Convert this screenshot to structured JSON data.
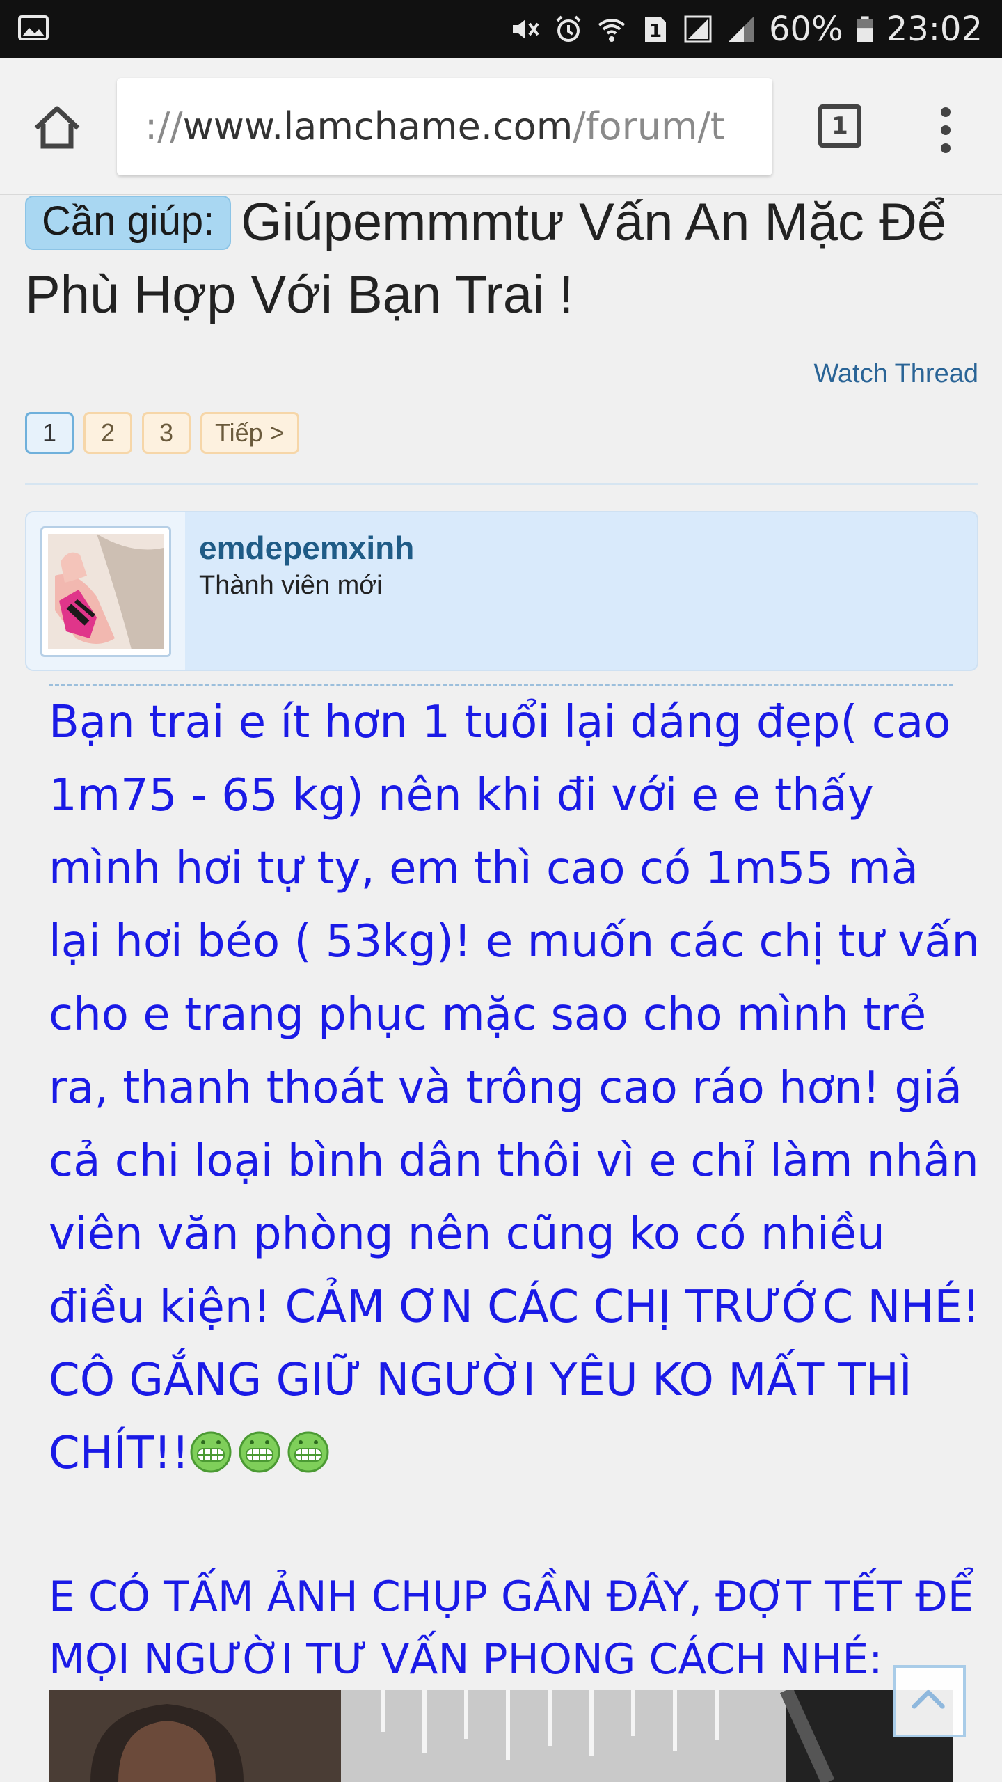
{
  "status_bar": {
    "battery": "60%",
    "time": "23:02",
    "sim_badge": "1",
    "icons": [
      "image-icon",
      "mute-icon",
      "alarm-icon",
      "wifi-icon",
      "sim-icon",
      "signal-icon",
      "battery-icon"
    ]
  },
  "browser": {
    "url_prefix": "://",
    "url_host": "www.lamchame.com",
    "url_path": "/forum/t",
    "tab_count": "1"
  },
  "thread": {
    "prefix": "Cần giúp:",
    "title": "Giúpemmmtư Vấn An Mặc Để Phù Hợp Với Bạn Trai !",
    "watch_label": "Watch Thread",
    "pages": [
      "1",
      "2",
      "3"
    ],
    "next_label": "Tiếp >",
    "current_page": "1"
  },
  "post": {
    "username": "emdepemxinh",
    "user_title": "Thành viên mới",
    "message": "Bạn trai e ít hơn 1 tuổi lại dáng đẹp( cao 1m75 - 65 kg) nên khi đi với e e thấy mình hơi tự ty, em thì cao có 1m55 mà lại hơi béo ( 53kg)! e muốn các chị tư vấn cho e trang phục mặc sao cho mình trẻ ra, thanh thoát và trông cao ráo hơn! giá cả chi loại bình dân thôi vì e chỉ làm nhân viên văn phòng nên cũng ko có nhiều điều kiện! CẢM ƠN CÁC CHỊ TRƯỚC NHÉ! CÔ GẮNG GIỮ NGƯỜI YÊU KO MẤT THÌ CHÍT!!",
    "emoji_count": 3,
    "message2": "E CÓ TẤM ẢNH CHỤP GẦN ĐÂY, ĐỢT TẾT ĐỂ MỌI NGƯỜI TƯ VẤN PHONG CÁCH NHÉ:"
  },
  "colors": {
    "message_text": "#1a1ae6",
    "username": "#1f5b86",
    "prefix_bg": "#a9d7f2",
    "userbox_bg": "#d9eafb"
  }
}
